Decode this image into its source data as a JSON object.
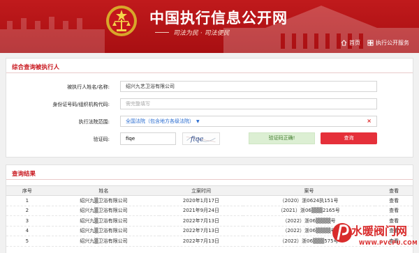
{
  "header": {
    "site_title": "中国执行信息公开网",
    "slogan": "司法为民 · 司法便民",
    "nav": [
      {
        "label": "首页",
        "icon": "home-icon"
      },
      {
        "label": "执行公开服务",
        "icon": "grid-icon"
      }
    ],
    "colors": {
      "header_bg": "#b51518",
      "accent": "#c8161d",
      "link": "#2a6cd0"
    }
  },
  "query": {
    "title": "综合查询被执行人",
    "name_label": "被执行人姓名/名称:",
    "name_value": "绍兴九艺卫浴有限公司",
    "id_label": "身份证号码/组织机构代码:",
    "id_placeholder": "需完整填写",
    "court_label": "执行法院范围:",
    "court_value": "全国法院（包含地方各级法院）",
    "court_clear": "×",
    "captcha_label": "验证码:",
    "captcha_value": "fiqe",
    "captcha_image_text": "fiqe",
    "captcha_status": "验证码正确!",
    "submit_label": "查询"
  },
  "results": {
    "title": "查询结果",
    "columns": [
      "序号",
      "姓名",
      "立案时间",
      "案号",
      "查看"
    ],
    "rows": [
      {
        "no": "1",
        "name": "绍兴九▒卫浴有限公司",
        "date": "2020年1月17日",
        "case": "（2020）浙0624执151号",
        "view": "查看"
      },
      {
        "no": "2",
        "name": "绍兴九▒卫浴有限公司",
        "date": "2021年9月24日",
        "case": "（2021）浙06▒▒▒2165号",
        "view": "查看"
      },
      {
        "no": "3",
        "name": "绍兴九▒卫浴有限公司",
        "date": "2022年7月13日",
        "case": "（2022）浙06▒▒▒▒号",
        "view": "查看"
      },
      {
        "no": "4",
        "name": "绍兴九▒卫浴有限公司",
        "date": "2022年7月13日",
        "case": "（2022）浙06▒▒▒▒号",
        "view": "查看"
      },
      {
        "no": "5",
        "name": "绍兴九▒卫浴有限公司",
        "date": "2022年7月13日",
        "case": "（2022）浙06▒▒▒575号",
        "view": "查看"
      }
    ]
  },
  "watermark": {
    "text": "水暖阀门网",
    "url": "WWW.PVCPU.COM"
  }
}
